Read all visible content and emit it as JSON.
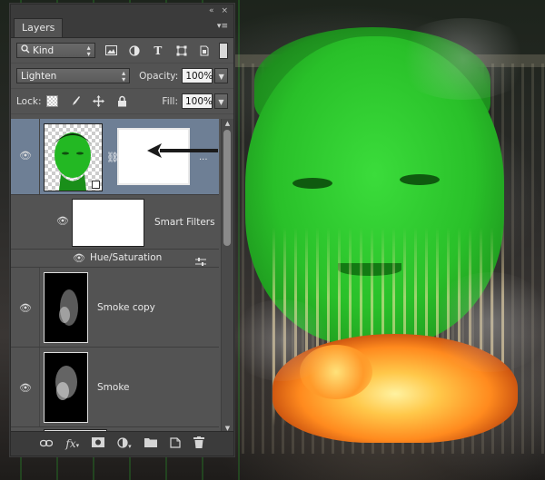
{
  "panel": {
    "tab_label": "Layers",
    "collapse_glyph": "«",
    "close_glyph": "×",
    "menu_glyph": "≡"
  },
  "filter_row": {
    "kind_label": "Kind",
    "icons": [
      "search-icon",
      "image-filter-icon",
      "adjustment-filter-icon",
      "type-filter-icon",
      "shape-filter-icon",
      "smart-object-filter-icon",
      "filter-toggle-icon"
    ]
  },
  "blend_row": {
    "blend_mode": "Lighten",
    "opacity_label": "Opacity:",
    "opacity_value": "100%"
  },
  "lock_row": {
    "lock_label": "Lock:",
    "icons": [
      "lock-transparent-icon",
      "lock-image-icon",
      "lock-position-icon",
      "lock-all-icon"
    ],
    "fill_label": "Fill:",
    "fill_value": "100%"
  },
  "layers": [
    {
      "name": "",
      "type": "smart-object",
      "selected": true
    },
    {
      "name": "Smart Filters",
      "type": "smart-filters"
    },
    {
      "name": "Hue/Saturation",
      "type": "filter"
    },
    {
      "name": "Smoke copy",
      "type": "pixel"
    },
    {
      "name": "Smoke",
      "type": "pixel"
    }
  ],
  "footer_icons": [
    "link-layers-icon",
    "fx-icon",
    "add-mask-icon",
    "adjustment-layer-icon",
    "new-group-icon",
    "new-layer-icon",
    "delete-layer-icon"
  ],
  "colors": {
    "panel_bg": "#535353",
    "selected_layer": "#6e7f95",
    "face_green": "#2fcf2f",
    "fire_orange": "#ff8a1e"
  }
}
